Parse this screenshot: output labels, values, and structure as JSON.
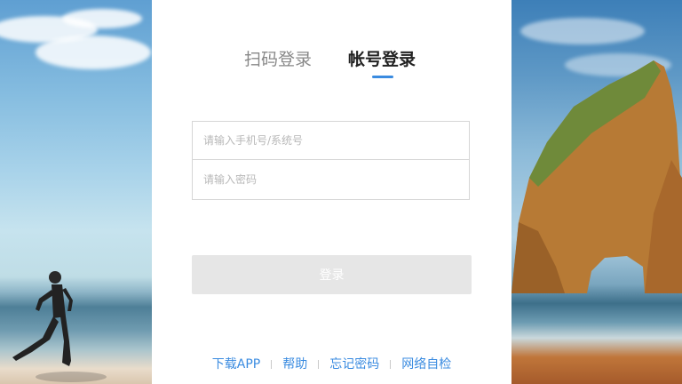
{
  "tabs": {
    "qr_login": "扫码登录",
    "account_login": "帐号登录",
    "active_color": "#3a8be0"
  },
  "form": {
    "phone_placeholder": "请输入手机号/系统号",
    "password_placeholder": "请输入密码",
    "login_button": "登录"
  },
  "footer": {
    "links": [
      "下载APP",
      "帮助",
      "忘记密码",
      "网络自检"
    ],
    "link_color": "#3a8be0"
  }
}
